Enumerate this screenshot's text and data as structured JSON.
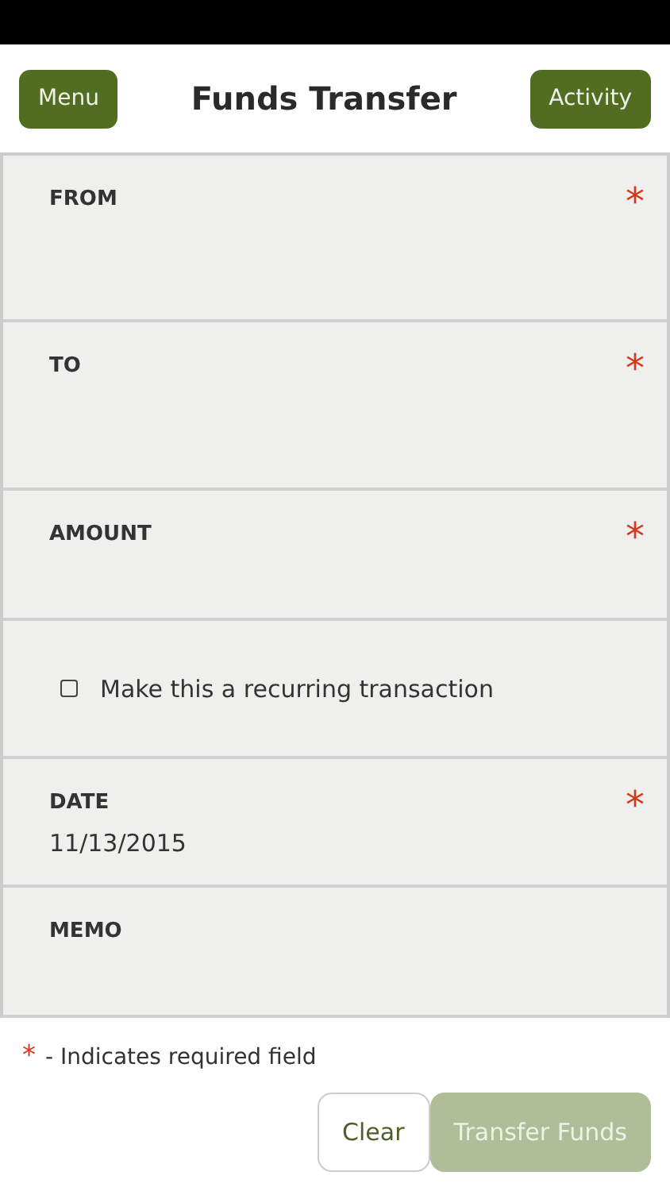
{
  "header": {
    "menu_button": "Menu",
    "title": "Funds Transfer",
    "activity_button": "Activity"
  },
  "fields": [
    {
      "kind": "field",
      "label": "FROM",
      "mark": "*"
    },
    {
      "kind": "field",
      "label": "TO",
      "mark": "*"
    },
    {
      "kind": "field",
      "label": "AMOUNT",
      "mark": "*"
    },
    {
      "kind": "checkbox",
      "label": "Make this a recurring transaction",
      "checked": false
    },
    {
      "kind": "field",
      "label": "DATE",
      "mark": "*",
      "value": "11/13/2015"
    },
    {
      "kind": "field",
      "label": "MEMO"
    }
  ],
  "legend": {
    "mark": "*",
    "text": "- Indicates required field"
  },
  "buttons": [
    {
      "label": "Clear",
      "disabled": false,
      "kind": "secondary"
    },
    {
      "label": "Transfer Funds",
      "disabled": true,
      "kind": "primary"
    }
  ]
}
